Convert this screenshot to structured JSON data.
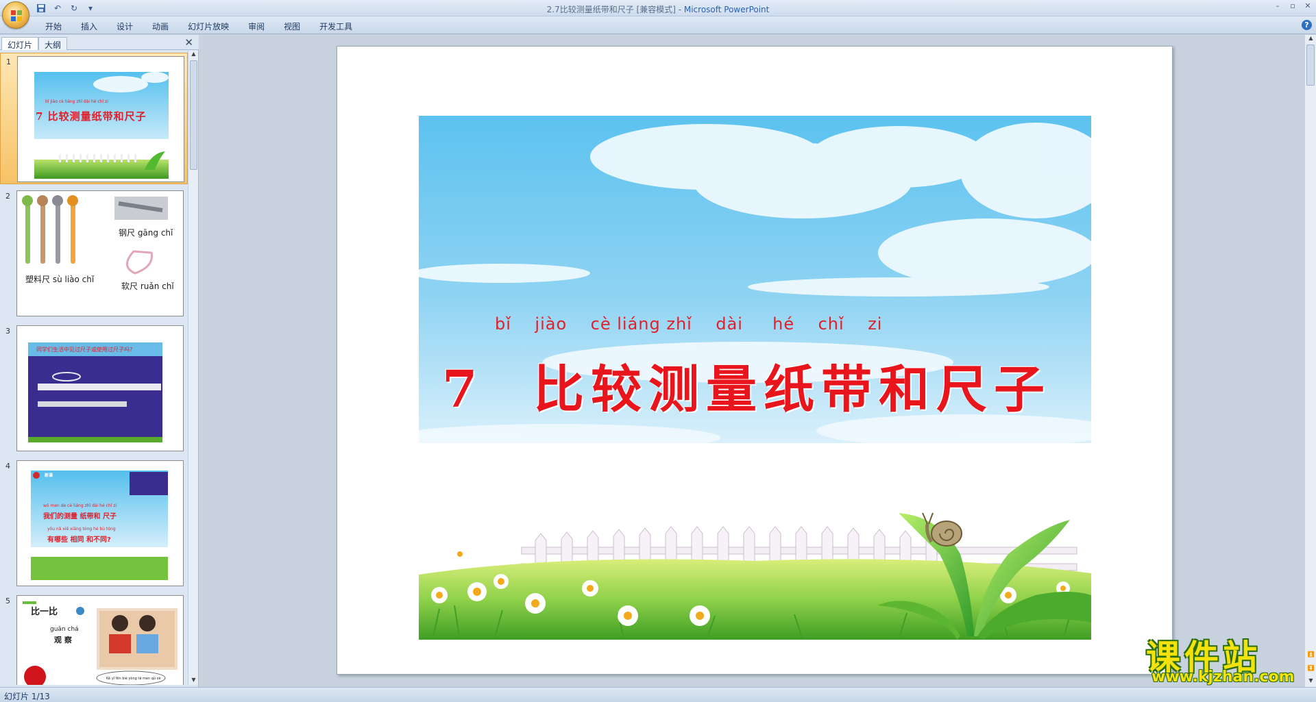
{
  "window": {
    "title_doc": "2.7比较测量纸带和尺子 [兼容模式] - ",
    "title_app": "Microsoft PowerPoint",
    "minimize": "–",
    "restore": "▫",
    "close": "✕"
  },
  "qat": {
    "save": "💾",
    "undo": "↶",
    "redo": "↻",
    "more": "▾"
  },
  "ribbon": {
    "tabs": [
      "开始",
      "插入",
      "设计",
      "动画",
      "幻灯片放映",
      "审阅",
      "视图",
      "开发工具"
    ],
    "help": "?"
  },
  "panel": {
    "tab_slides": "幻灯片",
    "tab_outline": "大纲",
    "close": "✕"
  },
  "thumbnails": [
    {
      "num": "1",
      "pinyin": "bǐ  jiào  cè liáng zhǐ  dài  hé  chǐ  zi",
      "title": "7 比较测量纸带和尺子"
    },
    {
      "num": "2",
      "label_steel": "钢尺 gāng chǐ",
      "label_plastic": "塑料尺 sù liào chǐ",
      "label_soft": "软尺 ruǎn chǐ"
    },
    {
      "num": "3",
      "question": "同学们生活中见过尺子或使用过尺子吗?"
    },
    {
      "num": "4",
      "badge": "新课",
      "line1_py": "wǒ men de cè liáng zhǐ dài hé chǐ zi",
      "line1": "我们的测量 纸带和 尺子",
      "line2_py": "yǒu nǎ xiē xiāng tóng hé bù tóng",
      "line2": "有哪些 相同 和不同?"
    },
    {
      "num": "5",
      "title": "比一比",
      "pinyin": "guān chá",
      "word": "观  察",
      "bubble": "Kě yǐ fēn bié yòng tā men qù cè"
    }
  ],
  "slide": {
    "pinyin": "bǐ    jiào    cè liáng zhǐ    dài     hé    chǐ    zi",
    "title": "7  比较测量纸带和尺子"
  },
  "status": {
    "slide_counter": "幻灯片 1/13"
  },
  "watermark": {
    "name": "课件站",
    "url": "www.kjzhan.com"
  },
  "colors": {
    "title_red": "#e8151c",
    "sky": "#5fc4ef",
    "grass": "#6cc13a",
    "selected_thumb": "#f7c266"
  }
}
